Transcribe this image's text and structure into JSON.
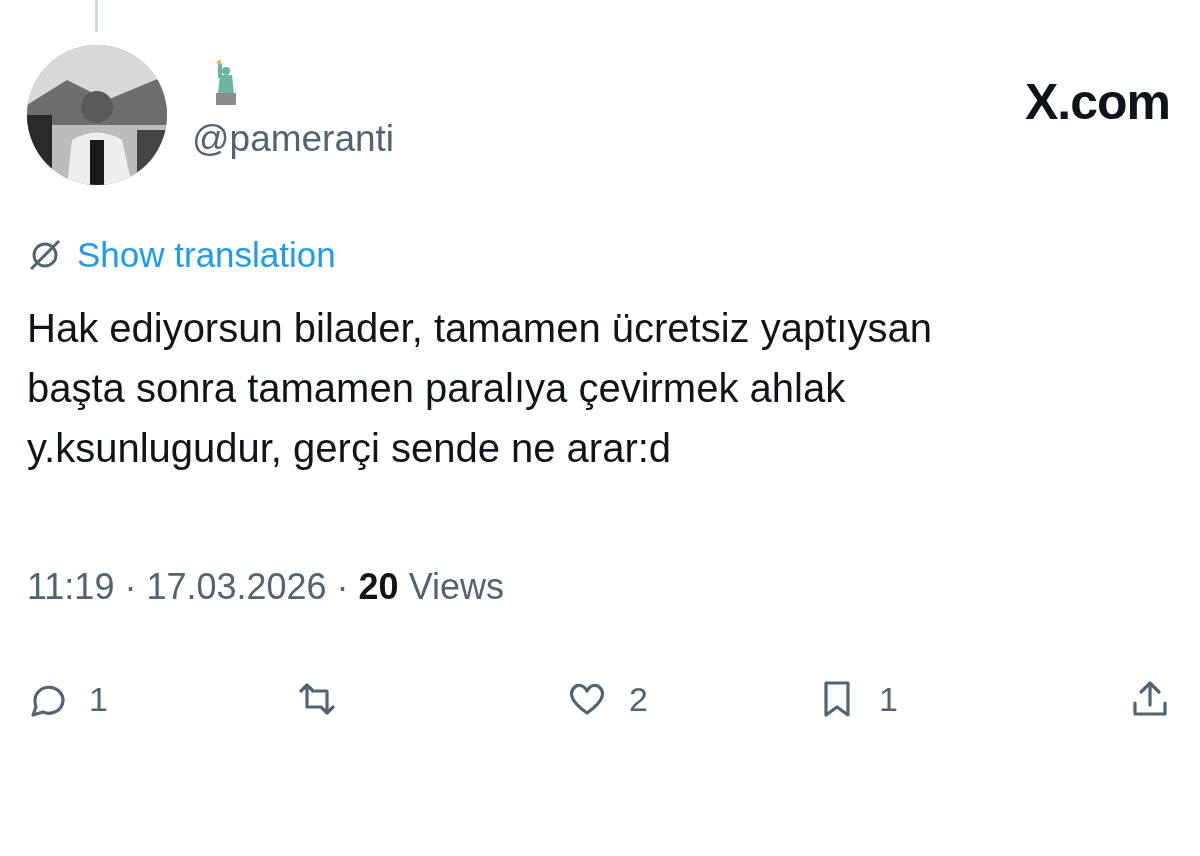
{
  "source_label": "X.com",
  "author": {
    "handle": "@pameranti"
  },
  "translation_link": "Show translation",
  "text": "Hak ediyorsun bilader, tamamen ücretsiz yaptıysan başta sonra tamamen paralıya çevirmek ahlak y.ksunlugudur, gerçi sende ne arar:d",
  "meta": "11:19 · 17.03.2026 · **20** Views",
  "actions": [
    {
      "kind": "reply",
      "count": "1"
    },
    {
      "kind": "repost"
    },
    {
      "kind": "like",
      "count": "2"
    },
    {
      "kind": "bookmark",
      "count": "1"
    },
    {
      "kind": "share"
    }
  ]
}
